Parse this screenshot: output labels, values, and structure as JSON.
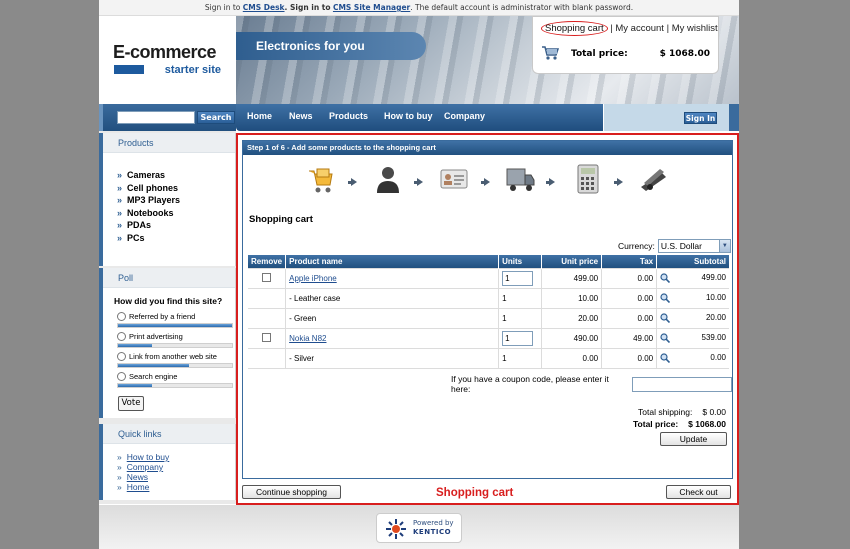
{
  "topbar": {
    "signin_prefix": "Sign in to",
    "cms_desk": "CMS Desk",
    "signin_mid": ". Sign in to",
    "cms_site_manager": "CMS Site Manager",
    "note": ". The default account is administrator with blank password."
  },
  "logo": {
    "line1": "E-commerce",
    "line2": "starter site"
  },
  "banner": {
    "tagline": "Electronics for you"
  },
  "cartbox": {
    "shopping_cart": "Shopping cart",
    "sep1": "|",
    "my_account": "My account",
    "sep2": "|",
    "my_wishlist": "My wishlist",
    "total_price_label": "Total price:",
    "total_price_value": "$ 1068.00",
    "cart_icon": "shopping-cart-icon"
  },
  "search": {
    "button": "Search"
  },
  "nav": {
    "items": [
      "Home",
      "News",
      "Products",
      "How to buy",
      "Company"
    ],
    "signin": "Sign In"
  },
  "sidebar": {
    "products_title": "Products",
    "products": [
      "Cameras",
      "Cell phones",
      "MP3 Players",
      "Notebooks",
      "PDAs",
      "PCs"
    ],
    "poll_title": "Poll",
    "poll_question": "How did you find this site?",
    "poll_options": [
      {
        "label": "Referred by a friend",
        "fill": 1.0
      },
      {
        "label": "Print advertising",
        "fill": 0.3
      },
      {
        "label": "Link from another web site",
        "fill": 0.62
      },
      {
        "label": "Search engine",
        "fill": 0.3
      }
    ],
    "vote": "Vote",
    "quick_title": "Quick links",
    "quick_links": [
      "How to buy",
      "Company",
      "News",
      "Home"
    ]
  },
  "wizard": {
    "header": "Step 1 of 6 - Add some products to the shopping cart",
    "steps": [
      "shopping-cart-step-icon",
      "customer-step-icon",
      "address-card-step-icon",
      "shipping-truck-step-icon",
      "calculator-payment-step-icon",
      "stapler-confirm-step-icon"
    ],
    "title": "Shopping cart",
    "currency_label": "Currency:",
    "currency_value": "U.S. Dollar",
    "columns": [
      "Remove",
      "Product name",
      "Units",
      "Unit price",
      "Tax",
      "Subtotal"
    ],
    "rows": [
      {
        "remove": true,
        "name": "Apple iPhone",
        "link": true,
        "units": "1",
        "unit_input": true,
        "unit_price": "499.00",
        "tax": "0.00",
        "subtotal": "499.00"
      },
      {
        "remove": false,
        "name": "- Leather case",
        "link": false,
        "units": "1",
        "unit_input": false,
        "unit_price": "10.00",
        "tax": "0.00",
        "subtotal": "10.00"
      },
      {
        "remove": false,
        "name": "- Green",
        "link": false,
        "units": "1",
        "unit_input": false,
        "unit_price": "20.00",
        "tax": "0.00",
        "subtotal": "20.00"
      },
      {
        "remove": true,
        "name": "Nokia N82",
        "link": true,
        "units": "1",
        "unit_input": true,
        "unit_price": "490.00",
        "tax": "49.00",
        "subtotal": "539.00"
      },
      {
        "remove": false,
        "name": "- Silver",
        "link": false,
        "units": "1",
        "unit_input": false,
        "unit_price": "0.00",
        "tax": "0.00",
        "subtotal": "0.00"
      }
    ],
    "coupon_label": "If you have a coupon code, please enter it here:",
    "total_shipping_label": "Total shipping:",
    "total_shipping_value": "$ 0.00",
    "total_price_label": "Total price:",
    "total_price_value": "$ 1068.00",
    "update": "Update"
  },
  "buttons": {
    "continue": "Continue shopping",
    "checkout": "Check out"
  },
  "annotation": "Shopping cart",
  "footer": {
    "powered_by": "Powered by",
    "brand": "KENTICO"
  },
  "colors": {
    "accent": "#2f5f92",
    "highlight": "#d81e1e"
  }
}
